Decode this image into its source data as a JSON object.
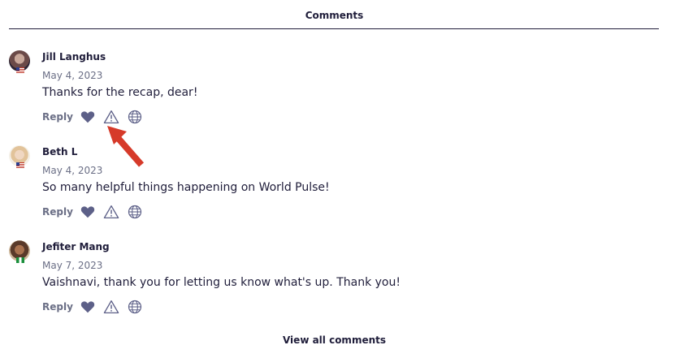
{
  "header": {
    "title": "Comments"
  },
  "comments": [
    {
      "author": "Jill Langhus",
      "date": "May 4, 2023",
      "text": "Thanks for the recap, dear!",
      "reply_label": "Reply",
      "flag": "us-flag"
    },
    {
      "author": "Beth L",
      "date": "May 4, 2023",
      "text": "So many helpful things happening on World Pulse!",
      "reply_label": "Reply",
      "flag": "us-flag"
    },
    {
      "author": "Jefiter Mang",
      "date": "May 7, 2023",
      "text": "Vaishnavi, thank you for letting us know what's up. Thank you!",
      "reply_label": "Reply",
      "flag": "nigeria-flag"
    }
  ],
  "footer": {
    "view_all_label": "View all comments"
  },
  "icons": {
    "like": "heart-icon",
    "report": "warning-triangle-icon",
    "translate": "globe-icon",
    "annotation": "red-arrow-pointer"
  },
  "colors": {
    "text_dark": "#1f1d3a",
    "muted": "#6b6f86",
    "icon": "#5d6088",
    "annotation_arrow": "#d63a2a"
  }
}
